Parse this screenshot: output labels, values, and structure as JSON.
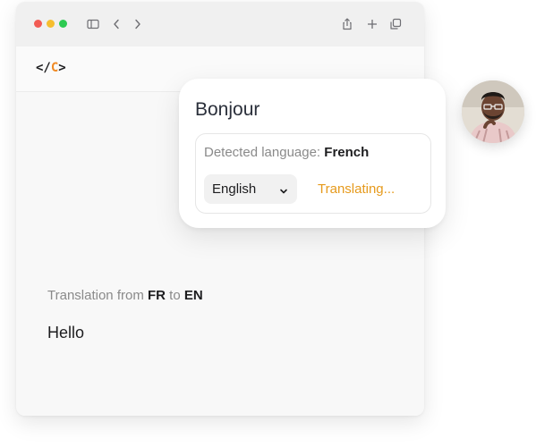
{
  "toolbar": {
    "icons": [
      "sidebar-icon",
      "chevron-left-icon",
      "chevron-right-icon",
      "share-icon",
      "plus-icon",
      "copy-icon"
    ]
  },
  "app": {
    "logo_open": "</",
    "logo_accent": "C",
    "logo_close": ">"
  },
  "popup": {
    "title": "Bonjour",
    "detected_label": "Detected language:",
    "detected_value": "French",
    "target_language": "English",
    "status": "Translating..."
  },
  "main": {
    "translation_prefix": "Translation from",
    "source_code": "FR",
    "to_word": "to",
    "target_code": "EN",
    "translated_text": "Hello"
  },
  "colors": {
    "accent": "#f08a24",
    "status": "#e69a1c"
  }
}
